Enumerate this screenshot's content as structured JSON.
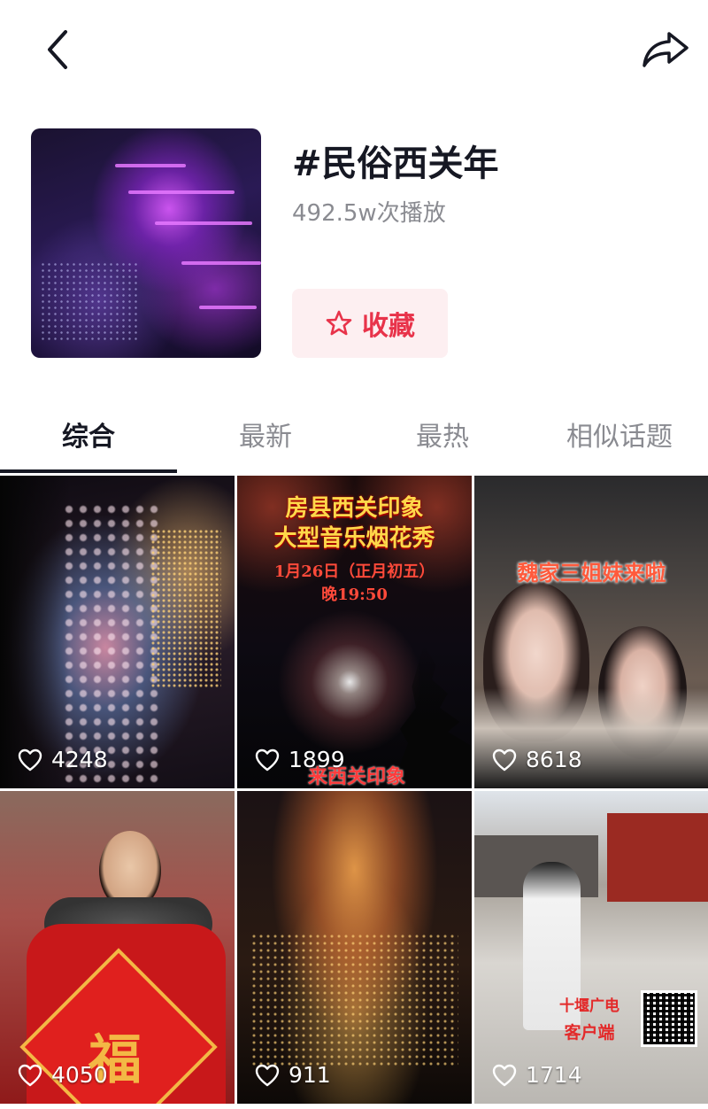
{
  "header": {
    "title": "#民俗西关年",
    "plays": "492.5w次播放",
    "favorite_label": "收藏"
  },
  "tabs": [
    {
      "label": "综合",
      "active": true
    },
    {
      "label": "最新",
      "active": false
    },
    {
      "label": "最热",
      "active": false
    },
    {
      "label": "相似话题",
      "active": false
    }
  ],
  "videos": [
    {
      "likes": "4248",
      "overlay": []
    },
    {
      "likes": "1899",
      "overlay": [
        "房县西关印象",
        "大型音乐烟花秀",
        "1月26日（正月初五）",
        "晚19:50",
        "来西关印象"
      ]
    },
    {
      "likes": "8618",
      "overlay": [
        "魏家三姐妹来啦"
      ]
    },
    {
      "likes": "4050",
      "overlay": [
        "福"
      ]
    },
    {
      "likes": "911",
      "overlay": []
    },
    {
      "likes": "1714",
      "overlay": [
        "十堰广电",
        "客户端"
      ]
    }
  ],
  "colors": {
    "accent": "#e8334a",
    "fav_bg": "#fdeff1",
    "text_primary": "#161823",
    "text_secondary": "#8a8b91"
  },
  "icons": {
    "back": "chevron-left-icon",
    "share": "share-arrow-icon",
    "favorite": "star-outline-icon",
    "like": "heart-outline-icon"
  }
}
